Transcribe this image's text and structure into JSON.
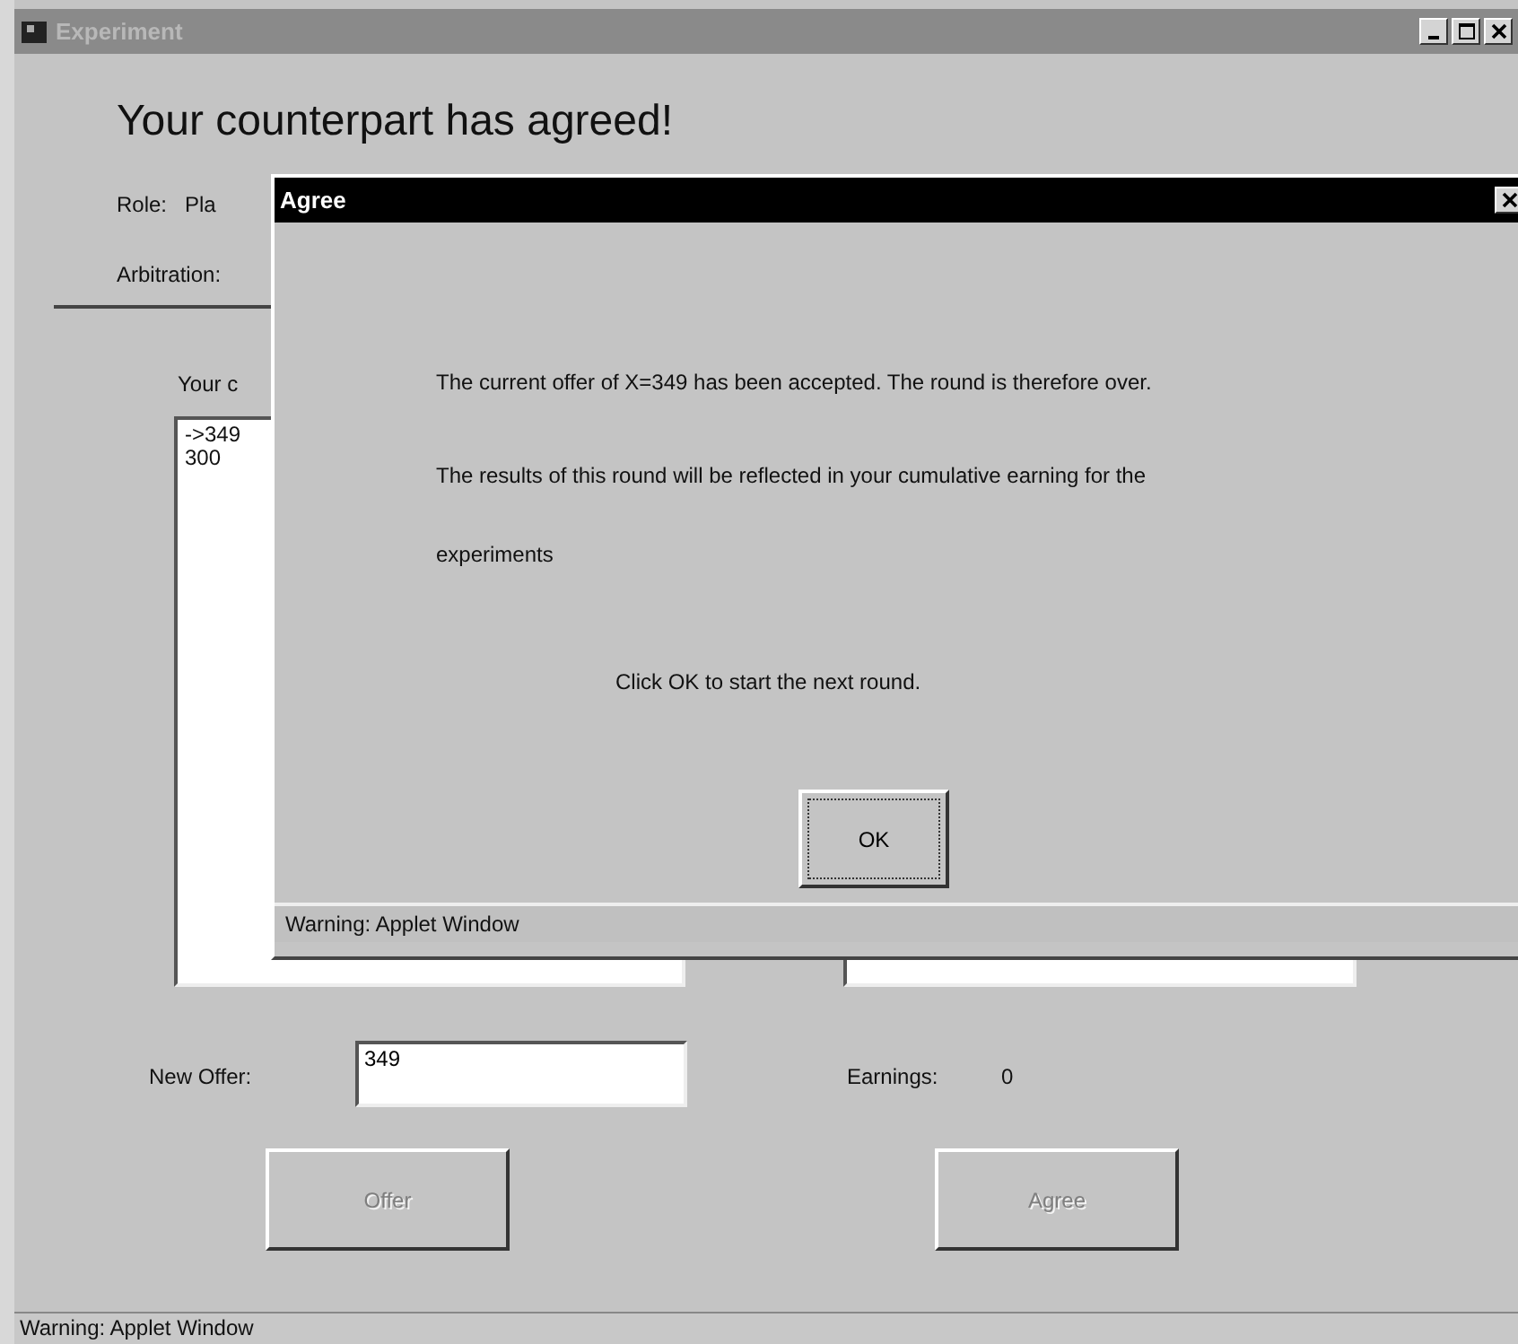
{
  "window": {
    "title": "Experiment",
    "active": false
  },
  "heading": "Your counterpart has agreed!",
  "role": {
    "label": "Role:",
    "value": "Pla"
  },
  "arbitration": {
    "label": "Arbitration:"
  },
  "offers_label": "Your c",
  "offers_list": [
    "->349",
    "300"
  ],
  "new_offer": {
    "label": "New Offer:",
    "value": "349"
  },
  "earnings": {
    "label": "Earnings:",
    "value": "0"
  },
  "buttons": [
    {
      "label": "Offer",
      "disabled": true
    },
    {
      "label": "Agree",
      "disabled": true
    }
  ],
  "status_bar": "Warning: Applet Window",
  "dialog": {
    "title": "Agree",
    "active": true,
    "messages": [
      "The current offer of X=349 has been accepted. The round is therefore over.",
      "The results of this round will be reflected in your cumulative earning for the",
      "experiments",
      "Click OK to start the next round."
    ],
    "button": {
      "label": "OK",
      "disabled": false
    },
    "status_bar": "Warning: Applet Window"
  }
}
